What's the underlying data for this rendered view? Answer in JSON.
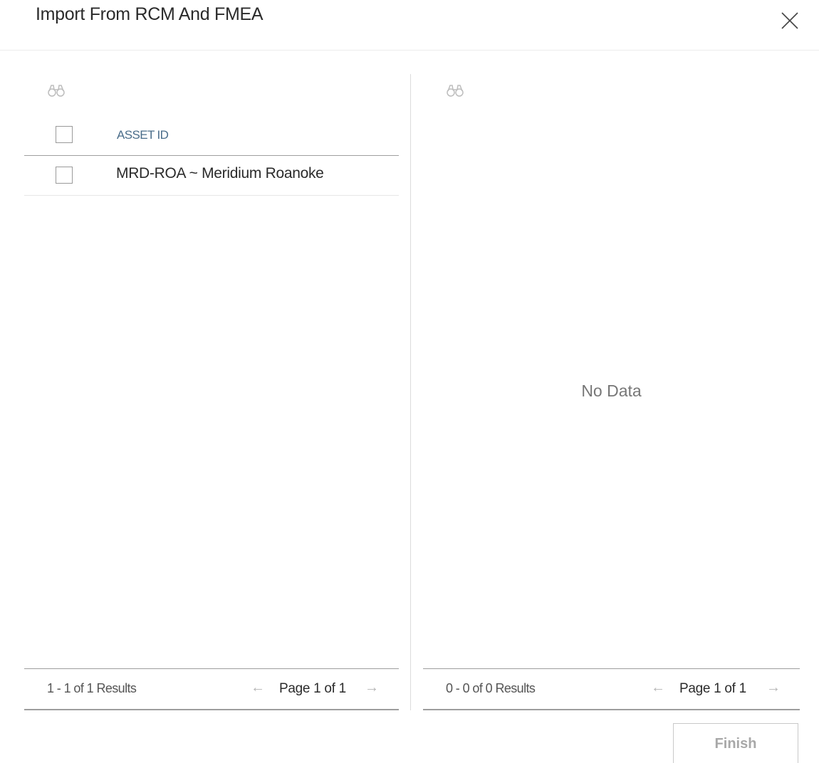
{
  "dialog": {
    "title": "Import From RCM And FMEA",
    "close_icon": "close-icon"
  },
  "left_panel": {
    "search_icon": "binoculars-icon",
    "grid": {
      "columns": [
        "ASSET ID"
      ],
      "rows": [
        {
          "asset_id": "MRD-ROA ~ Meridium Roanoke",
          "selected": false
        }
      ]
    },
    "footer": {
      "results": "1 - 1 of 1 Results",
      "page": "Page 1 of 1",
      "prev_icon": "arrow-left-icon",
      "next_icon": "arrow-right-icon"
    }
  },
  "right_panel": {
    "search_icon": "binoculars-icon",
    "empty_text": "No Data",
    "footer": {
      "results": "0 - 0 of 0 Results",
      "page": "Page 1 of 1",
      "prev_icon": "arrow-left-icon",
      "next_icon": "arrow-right-icon"
    }
  },
  "actions": {
    "finish_label": "Finish",
    "finish_enabled": false
  }
}
